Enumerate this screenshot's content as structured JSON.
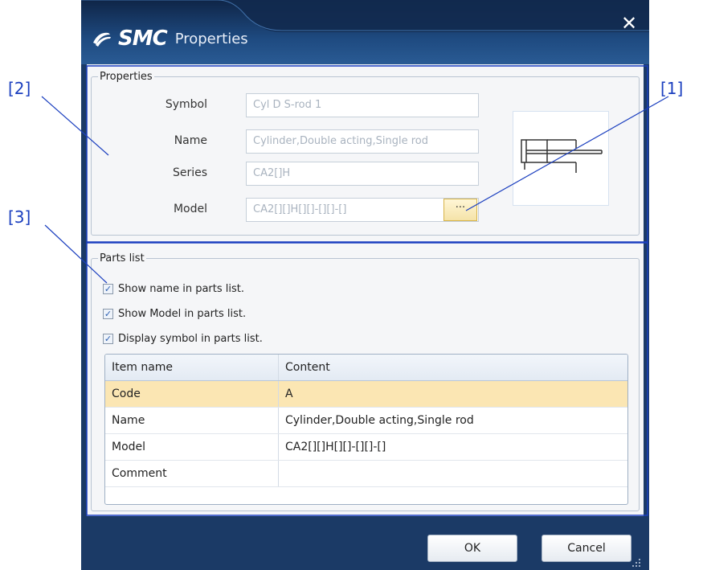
{
  "window": {
    "brand": "SMC",
    "title": "Properties",
    "close_glyph": "✕"
  },
  "properties": {
    "legend": "Properties",
    "fields": [
      {
        "label": "Symbol",
        "value": "Cyl D S-rod 1"
      },
      {
        "label": "Name",
        "value": "Cylinder,Double acting,Single rod"
      },
      {
        "label": "Series",
        "value": "CA2[]H"
      },
      {
        "label": "Model",
        "value": "CA2[][]H[][]-[][]-[]"
      }
    ],
    "browse_label": "···",
    "symbol_icon": "double-acting-cylinder-symbol"
  },
  "parts_list": {
    "legend": "Parts list",
    "checkboxes": [
      {
        "label": "Show name in parts list.",
        "checked": true
      },
      {
        "label": "Show Model in parts list.",
        "checked": true
      },
      {
        "label": "Display symbol in parts list.",
        "checked": true
      }
    ],
    "check_glyph": "✓",
    "columns": [
      "Item name",
      "Content"
    ],
    "rows": [
      {
        "name": "Code",
        "content": "A"
      },
      {
        "name": "Name",
        "content": "Cylinder,Double acting,Single rod"
      },
      {
        "name": "Model",
        "content": "CA2[][]H[][]-[][]-[]"
      },
      {
        "name": "Comment",
        "content": ""
      }
    ]
  },
  "footer": {
    "ok_label": "OK",
    "cancel_label": "Cancel"
  },
  "callouts": {
    "c1": "[1]",
    "c2": "[2]",
    "c3": "[3]"
  },
  "colors": {
    "frame": "#1b3a66",
    "callout": "#1b3fbf",
    "selected_row": "#fbe6b3"
  }
}
